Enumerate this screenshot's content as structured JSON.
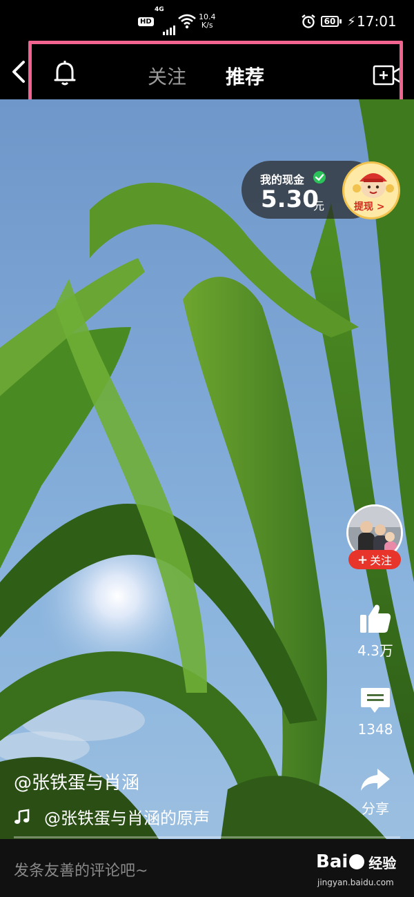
{
  "status_bar": {
    "hd": "HD",
    "network": "4G",
    "speed_value": "10.4",
    "speed_unit": "K/s",
    "battery": "60",
    "time": "17:01"
  },
  "top_nav": {
    "tabs": [
      {
        "label": "关注",
        "active": false
      },
      {
        "label": "推荐",
        "active": true
      }
    ],
    "highlight_color": "#f0648f"
  },
  "cash_widget": {
    "label": "我的现金",
    "amount": "5.30",
    "unit": "元",
    "withdraw_label": "提现 >"
  },
  "actions": {
    "follow_label": "关注",
    "like_count": "4.3万",
    "comment_count": "1348",
    "share_label": "分享"
  },
  "caption": {
    "author": "@张铁蛋与肖涵",
    "music": "@张铁蛋与肖涵的原声"
  },
  "bottom_bar": {
    "comment_placeholder": "发条友善的评论吧~"
  },
  "watermark": {
    "brand_left": "Bai",
    "brand_right": "经验",
    "url": "jingyan.baidu.com"
  }
}
